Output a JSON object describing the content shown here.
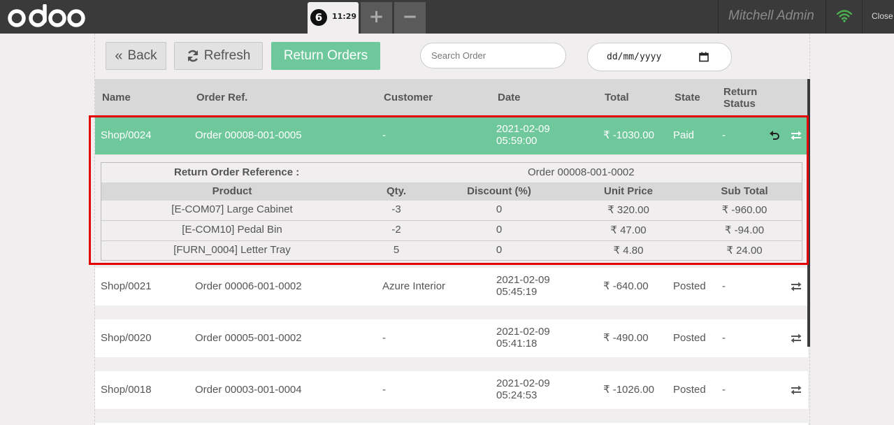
{
  "topbar": {
    "logo": "odoo",
    "order_sequence": "6",
    "order_time": "11:29",
    "add_label": "+",
    "remove_label": "−",
    "username": "Mitchell Admin",
    "close_label": "Close"
  },
  "toolbar": {
    "back_label": "Back",
    "refresh_label": "Refresh",
    "return_orders_label": "Return Orders",
    "search_placeholder": "Search Order",
    "date_placeholder": "dd/mm/yyyy"
  },
  "table": {
    "headers": {
      "name": "Name",
      "order_ref": "Order Ref.",
      "customer": "Customer",
      "date": "Date",
      "total": "Total",
      "state": "State",
      "return_status_1": "Return",
      "return_status_2": "Status"
    },
    "rows": [
      {
        "name": "Shop/0024",
        "order_ref": "Order 00008-001-0005",
        "customer": "-",
        "date": "2021-02-09",
        "time": "05:59:00",
        "total": "₹ -1030.00",
        "state": "Paid",
        "return_status": "-"
      },
      {
        "name": "Shop/0021",
        "order_ref": "Order 00006-001-0002",
        "customer": "Azure Interior",
        "date": "2021-02-09",
        "time": "05:45:19",
        "total": "₹ -640.00",
        "state": "Posted",
        "return_status": "-"
      },
      {
        "name": "Shop/0020",
        "order_ref": "Order 00005-001-0002",
        "customer": "-",
        "date": "2021-02-09",
        "time": "05:41:18",
        "total": "₹ -490.00",
        "state": "Posted",
        "return_status": "-"
      },
      {
        "name": "Shop/0018",
        "order_ref": "Order 00003-001-0004",
        "customer": "-",
        "date": "2021-02-09",
        "time": "05:24:53",
        "total": "₹ -1026.00",
        "state": "Posted",
        "return_status": "-"
      }
    ]
  },
  "detail": {
    "return_ref_label": "Return Order Reference :",
    "return_ref_value": "Order 00008-001-0002",
    "headers": {
      "product": "Product",
      "qty": "Qty.",
      "discount": "Discount (%)",
      "unit_price": "Unit Price",
      "sub_total": "Sub Total"
    },
    "lines": [
      {
        "product": "[E-COM07] Large Cabinet",
        "qty": "-3",
        "discount": "0",
        "unit_price": "₹ 320.00",
        "sub_total": "₹ -960.00"
      },
      {
        "product": "[E-COM10] Pedal Bin",
        "qty": "-2",
        "discount": "0",
        "unit_price": "₹ 47.00",
        "sub_total": "₹ -94.00"
      },
      {
        "product": "[FURN_0004] Letter Tray",
        "qty": "5",
        "discount": "0",
        "unit_price": "₹ 4.80",
        "sub_total": "₹ 24.00"
      }
    ]
  },
  "colors": {
    "topbar": "#3a3a3a",
    "accent_green": "#6ec89b",
    "wifi_green": "#4caf50",
    "highlight_red": "#e00000"
  },
  "icons": {
    "back": "double-chevron-left-icon",
    "refresh": "refresh-icon",
    "wifi": "wifi-icon",
    "calendar": "calendar-icon",
    "undo": "undo-icon",
    "exchange": "exchange-icon"
  }
}
